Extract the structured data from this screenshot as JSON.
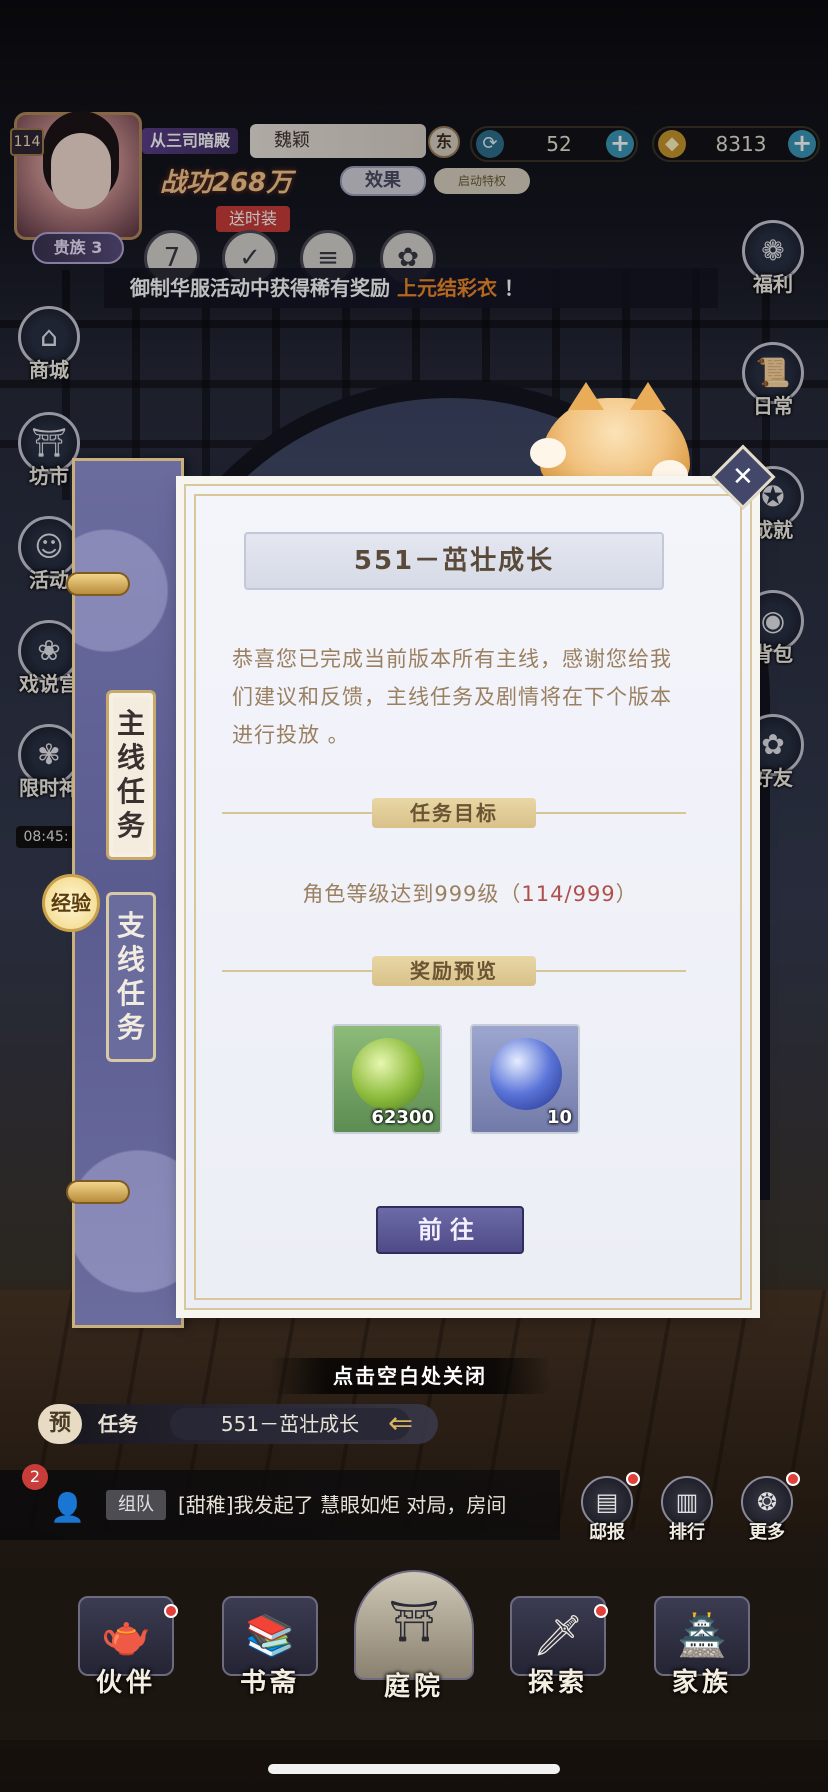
{
  "hud": {
    "level": "114",
    "rank": "从三司暗殿",
    "player_name": "魏颖",
    "power": "战功268万",
    "effect_label": "效果",
    "privilege_label": "启动特权",
    "outfit_badge": "送时装",
    "noble_label": "贵族 3",
    "region_badge": "东",
    "currency1_value": "52",
    "currency2_value": "8313",
    "currency1_icon": "refresh-coin-icon",
    "currency2_icon": "gold-ingot-icon"
  },
  "marquee": {
    "prefix": "御制华服活动中获得稀有奖励",
    "highlight": "上元结彩衣",
    "suffix": "！"
  },
  "left_nav": [
    {
      "label": "商城",
      "icon": "shop-icon"
    },
    {
      "label": "坊市",
      "icon": "market-icon"
    },
    {
      "label": "活动",
      "icon": "event-icon"
    },
    {
      "label": "戏说宫",
      "icon": "opera-icon"
    },
    {
      "label": "限时神",
      "icon": "limited-icon"
    }
  ],
  "time_chip": "08:45:",
  "right_nav": [
    {
      "label": "福利",
      "icon": "gift-icon"
    },
    {
      "label": "日常",
      "icon": "scroll-icon"
    },
    {
      "label": "成就",
      "icon": "achievement-icon"
    },
    {
      "label": "背包",
      "icon": "bag-icon"
    },
    {
      "label": "好友",
      "icon": "friend-icon"
    }
  ],
  "dialog": {
    "tab_main": "主线任务",
    "tab_side": "支线任务",
    "exp_badge": "经验",
    "title": "551－茁壮成长",
    "description": "恭喜您已完成当前版本所有主线，感谢您给我们建议和反馈，主线任务及剧情将在下个版本进行投放 。",
    "goal_section": "任务目标",
    "goal_text": "角色等级达到999级（",
    "goal_progress": "114/999",
    "goal_end": "）",
    "reward_section": "奖励预览",
    "rewards": [
      {
        "name": "exp-herb",
        "qty": "62300"
      },
      {
        "name": "crystal-orb",
        "qty": "10"
      }
    ],
    "go_button": "前往",
    "close_hint": "点击空白处关闭"
  },
  "task_bar": {
    "prefix": "预",
    "label": "任务",
    "name": "551－茁壮成长"
  },
  "chat": {
    "badge": "2",
    "tag": "组队",
    "message": "[甜稚]我发起了 慧眼如炬 对局，房间"
  },
  "util_buttons": [
    {
      "label": "邸报",
      "icon": "newspaper-icon"
    },
    {
      "label": "排行",
      "icon": "ranking-icon"
    },
    {
      "label": "更多",
      "icon": "more-icon"
    }
  ],
  "bottom_nav": [
    {
      "label": "伙伴",
      "icon": "teapot-icon"
    },
    {
      "label": "书斋",
      "icon": "books-icon"
    },
    {
      "label": "庭院",
      "icon": "pavilion-icon"
    },
    {
      "label": "探索",
      "icon": "explore-icon"
    },
    {
      "label": "家族",
      "icon": "clan-icon"
    }
  ]
}
